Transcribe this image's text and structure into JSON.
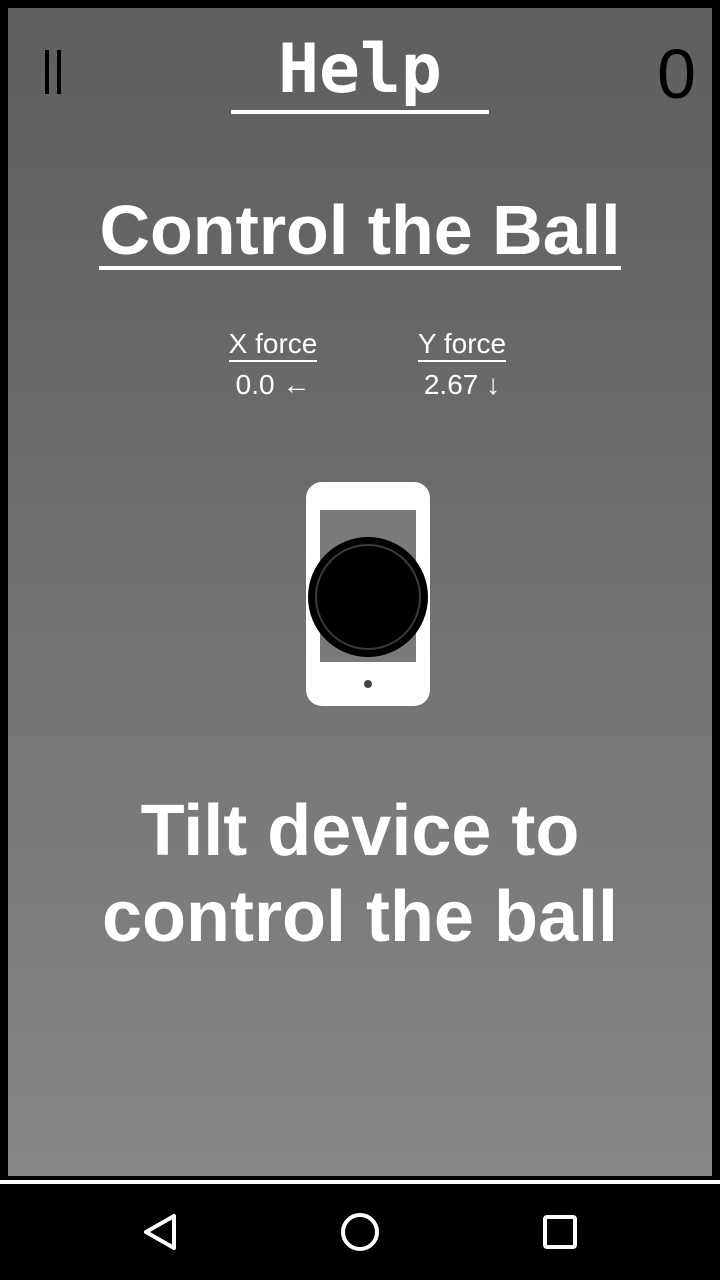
{
  "header": {
    "title": "Help",
    "score": "0",
    "pause_icon": "pause-icon"
  },
  "main": {
    "heading": "Control the Ball",
    "x_force": {
      "label": "X force",
      "value": "0.0 ←"
    },
    "y_force": {
      "label": "Y force",
      "value": "2.67 ↓"
    },
    "illustration_icon": "phone-tilt-ball-icon",
    "instruction_line1": "Tilt device to",
    "instruction_line2": "control the ball"
  },
  "nav_bar": {
    "back_icon": "back-triangle-icon",
    "home_icon": "home-circle-icon",
    "recents_icon": "recents-square-icon"
  },
  "colors": {
    "text": "#ffffff",
    "background_top": "#5f5f5f",
    "background_bottom": "#868686",
    "frame_border": "#000000",
    "nav_bar": "#000000"
  }
}
